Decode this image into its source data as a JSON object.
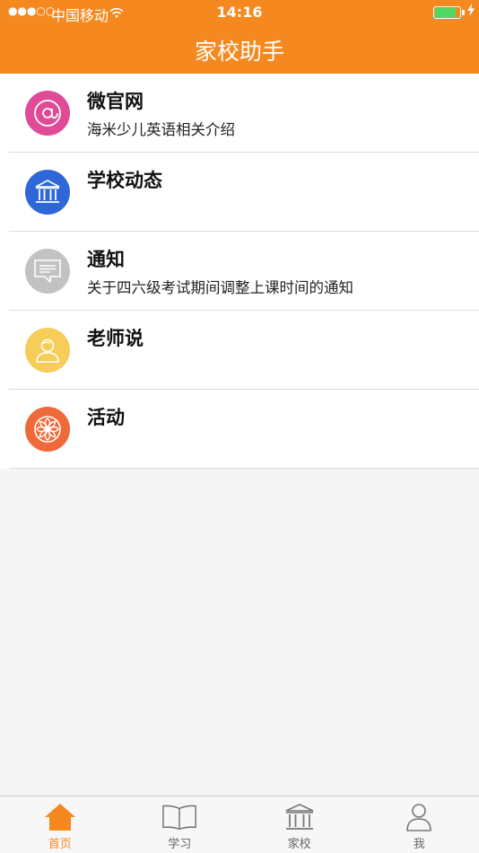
{
  "status_bar": {
    "signal": "●●●○○",
    "carrier": "中国移动",
    "time": "14:16"
  },
  "nav": {
    "title": "家校助手"
  },
  "colors": {
    "accent": "#f5891f",
    "pink": "#e04a97",
    "blue": "#2f67d8",
    "gray": "#c2c2c2",
    "yellow": "#f6cd58",
    "orange": "#ef6a3a"
  },
  "list": [
    {
      "title": "微官网",
      "subtitle": "海米少儿英语相关介绍",
      "icon": "at-sign-icon"
    },
    {
      "title": "学校动态",
      "subtitle": "",
      "icon": "school-building-icon"
    },
    {
      "title": "通知",
      "subtitle": "关于四六级考试期间调整上课时间的通知",
      "icon": "message-icon"
    },
    {
      "title": "老师说",
      "subtitle": "",
      "icon": "teacher-icon"
    },
    {
      "title": "活动",
      "subtitle": "",
      "icon": "orange-slice-icon"
    }
  ],
  "tabbar": [
    {
      "label": "首页",
      "icon": "home-icon",
      "active": true
    },
    {
      "label": "学习",
      "icon": "book-icon",
      "active": false
    },
    {
      "label": "家校",
      "icon": "school-icon",
      "active": false
    },
    {
      "label": "我",
      "icon": "user-icon",
      "active": false
    }
  ]
}
